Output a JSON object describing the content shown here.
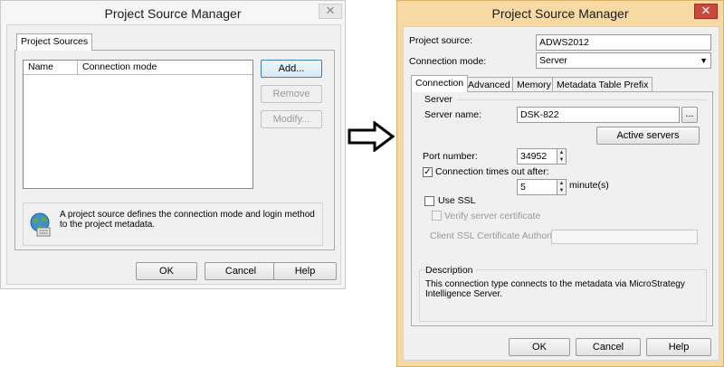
{
  "left_dialog": {
    "title": "Project Source Manager",
    "close_glyph": "✕",
    "tab": "Project Sources",
    "columns": [
      "Name",
      "Connection mode"
    ],
    "buttons": {
      "add": "Add...",
      "remove": "Remove",
      "modify": "Modify..."
    },
    "info_text": "A project source defines the connection mode and login method to the project metadata.",
    "footer": {
      "ok": "OK",
      "cancel": "Cancel",
      "help": "Help"
    }
  },
  "arrow": {
    "icon": "right-arrow-icon"
  },
  "right_dialog": {
    "title": "Project Source Manager",
    "close_glyph": "✕",
    "project_source_label": "Project source:",
    "project_source_value": "ADWS2012",
    "connection_mode_label": "Connection mode:",
    "connection_mode_value": "Server",
    "tabs": [
      "Connection",
      "Advanced",
      "Memory",
      "Metadata Table Prefix"
    ],
    "server_group": "Server",
    "server_name_label": "Server name:",
    "server_name_value": "DSK-822",
    "browse_label": "...",
    "active_servers_label": "Active servers",
    "port_label": "Port number:",
    "port_value": "34952",
    "timeout_label": "Connection times out after:",
    "timeout_checked": true,
    "timeout_value": "5",
    "timeout_unit": "minute(s)",
    "use_ssl_label": "Use SSL",
    "verify_cert_label": "Verify server certificate",
    "ssl_ca_label": "Client SSL Certificate Authority",
    "description_title": "Description",
    "description_text": "This connection type connects to the metadata via MicroStrategy Intelligence Server.",
    "footer": {
      "ok": "OK",
      "cancel": "Cancel",
      "help": "Help"
    }
  },
  "colors": {
    "right_window_frame": "#f6d9a3",
    "close_red": "#c94a3c",
    "focus_blue": "#3c7fb1"
  }
}
